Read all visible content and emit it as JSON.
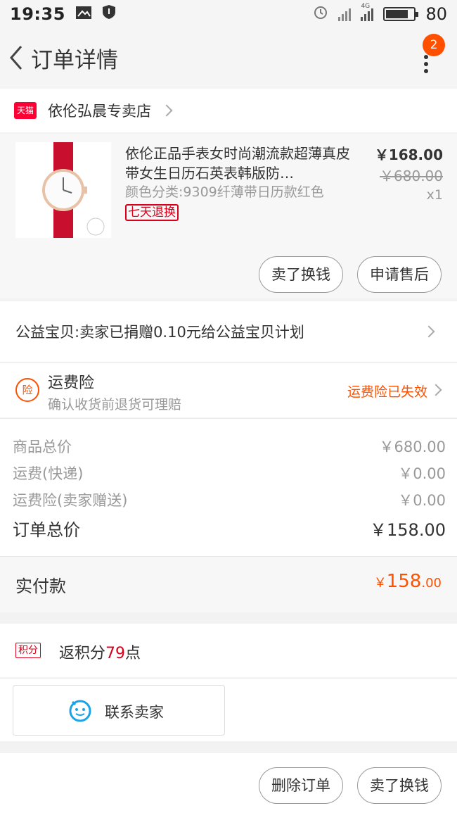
{
  "status_bar": {
    "time": "19:35",
    "battery": "80",
    "network": "4G",
    "battery_level": 0.8
  },
  "header": {
    "title": "订单详情",
    "badge_count": "2"
  },
  "shop": {
    "name": "依伦弘晨专卖店",
    "tag": "天猫"
  },
  "item": {
    "name": "依伦正品手表女时尚潮流款超薄真皮带女生日历石英表韩版防…",
    "sku": "颜色分类:9309纤薄带日历款红色",
    "tag": "七天退换",
    "price": "￥168.00",
    "original_price": "￥680.00",
    "quantity": "x1",
    "buttons": {
      "sell": "卖了换钱",
      "after_sale": "申请售后"
    }
  },
  "charity": {
    "text": "公益宝贝:卖家已捐赠0.10元给公益宝贝计划"
  },
  "insurance": {
    "icon_text": "险",
    "title": "运费险",
    "subtitle": "确认收货前退货可理赔",
    "status": "运费险已失效"
  },
  "summary": {
    "rows": [
      {
        "label": "商品总价",
        "value": "￥680.00"
      },
      {
        "label": "运费(快递)",
        "value": "￥0.00"
      },
      {
        "label": "运费险(卖家赠送)",
        "value": "￥0.00"
      }
    ],
    "total_label": "订单总价",
    "total_value": "￥158.00"
  },
  "payment": {
    "label": "实付款",
    "currency": "￥",
    "integer": "158",
    "decimal": ".00"
  },
  "points": {
    "tag": "积分",
    "prefix": "返积分",
    "count": "79",
    "suffix": "点"
  },
  "contact": {
    "label": "联系卖家"
  },
  "bottom": {
    "delete": "删除订单",
    "sell": "卖了换钱"
  },
  "colors": {
    "accent": "#ff5000",
    "tmall": "#ff0036",
    "tag_red": "#d9001b"
  }
}
